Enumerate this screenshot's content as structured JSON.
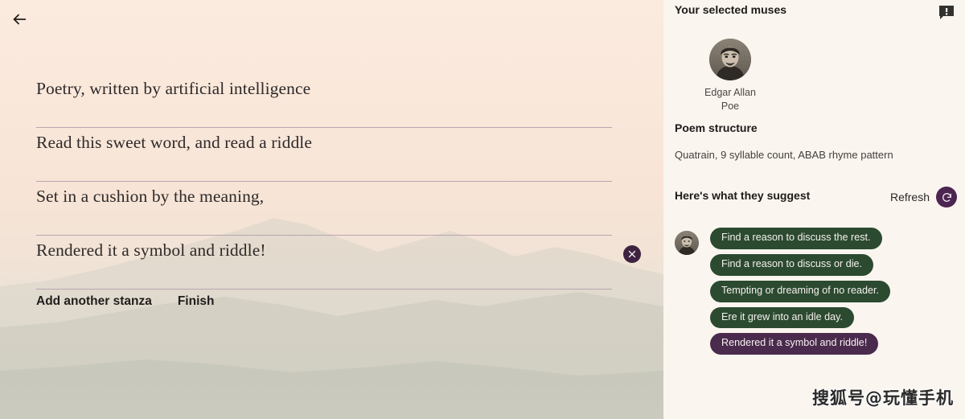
{
  "colors": {
    "page_bg": "#f9ece0",
    "sidebar_bg": "#faf5ef",
    "chip_green": "#2c4a30",
    "chip_purple": "#4a2a4d",
    "accent_purple": "#4c2550",
    "line_rule": "#b9a6b2",
    "text_dark": "#1d1a19"
  },
  "editor": {
    "back_icon": "arrow-left-icon",
    "lines": [
      {
        "text": "Poetry, written by artificial intelligence",
        "has_clear": false
      },
      {
        "text": "Read this sweet word, and read a riddle",
        "has_clear": false
      },
      {
        "text": "Set in a cushion by the meaning,",
        "has_clear": false
      },
      {
        "text": "Rendered it a symbol and riddle!",
        "has_clear": true
      }
    ],
    "clear_icon": "close-circle-icon",
    "actions": [
      {
        "label": "Add another stanza",
        "name": "add-another-stanza-button"
      },
      {
        "label": "Finish",
        "name": "finish-button"
      }
    ]
  },
  "sidebar": {
    "title": "Your selected muses",
    "feedback_icon": "feedback-flag-icon",
    "muse": {
      "name": "Edgar Allan Poe",
      "avatar_icon": "muse-portrait-icon"
    },
    "structure": {
      "title": "Poem structure",
      "text": "Quatrain, 9 syllable count, ABAB rhyme pattern"
    },
    "suggestions": {
      "title": "Here's what they suggest",
      "refresh_label": "Refresh",
      "refresh_icon": "refresh-ccw-icon",
      "avatar_icon": "muse-portrait-small-icon",
      "chips": [
        {
          "text": "Find a reason to discuss the rest.",
          "style": "green"
        },
        {
          "text": "Find a reason to discuss or die.",
          "style": "green"
        },
        {
          "text": "Tempting or dreaming of no reader.",
          "style": "green"
        },
        {
          "text": "Ere it grew into an idle day.",
          "style": "green"
        },
        {
          "text": "Rendered it a symbol and riddle!",
          "style": "purple"
        }
      ]
    }
  },
  "watermark": {
    "text": "搜狐号@玩懂手机"
  }
}
